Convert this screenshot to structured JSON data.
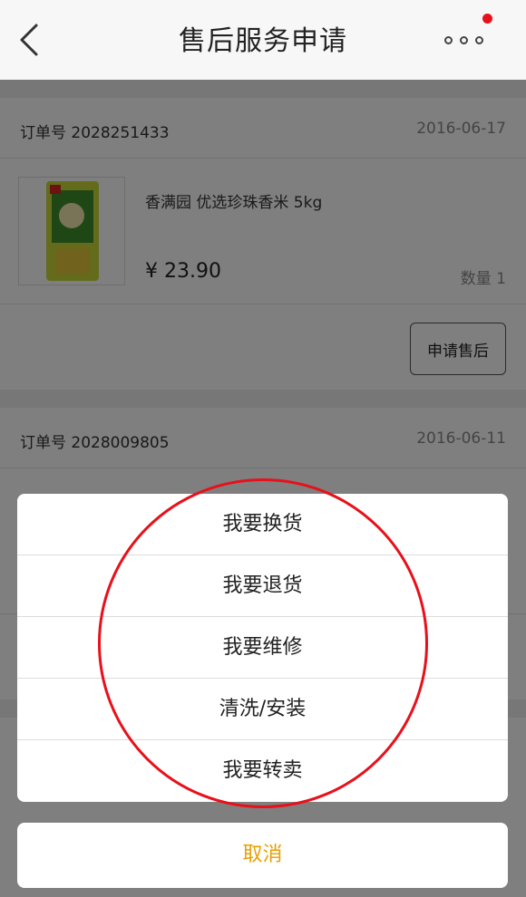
{
  "header": {
    "title": "售后服务申请",
    "back_icon": "chevron-left-icon",
    "more_icon": "more-dots-icon",
    "badge_color": "#e8101a"
  },
  "orders": [
    {
      "order_no": "订单号 2028251433",
      "date": "2016-06-17",
      "product_name": "香满园 优选珍珠香米 5kg",
      "price": "¥ 23.90",
      "quantity": "数量 1",
      "apply_label": "申请售后"
    },
    {
      "order_no": "订单号 2028009805",
      "date": "2016-06-11"
    }
  ],
  "action_sheet": {
    "items": [
      "我要换货",
      "我要退货",
      "我要维修",
      "清洗/安装",
      "我要转卖"
    ],
    "cancel_label": "取消",
    "cancel_color": "#e8a000",
    "highlight_color": "#e8101a"
  }
}
